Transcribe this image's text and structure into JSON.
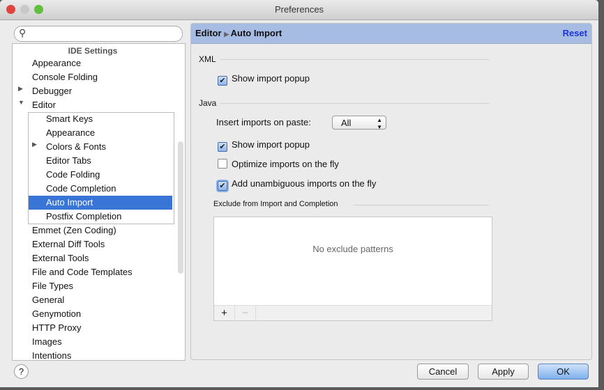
{
  "window": {
    "title": "Preferences"
  },
  "search": {
    "placeholder": ""
  },
  "tree": {
    "header": "IDE Settings",
    "items_top": [
      "Appearance",
      "Console Folding",
      "Debugger",
      "Editor"
    ],
    "editor_children": [
      "Smart Keys",
      "Appearance",
      "Colors & Fonts",
      "Editor Tabs",
      "Code Folding",
      "Code Completion",
      "Auto Import",
      "Postfix Completion"
    ],
    "items_bottom": [
      "Emmet (Zen Coding)",
      "External Diff Tools",
      "External Tools",
      "File and Code Templates",
      "File Types",
      "General",
      "Genymotion",
      "HTTP Proxy",
      "Images",
      "Intentions"
    ]
  },
  "header": {
    "breadcrumb_parent": "Editor",
    "breadcrumb_current": "Auto Import",
    "reset": "Reset"
  },
  "xml": {
    "title": "XML",
    "show_popup": "Show import popup",
    "show_popup_checked": true
  },
  "java": {
    "title": "Java",
    "insert_label": "Insert imports on paste:",
    "insert_value": "All",
    "show_popup": "Show import popup",
    "show_popup_checked": true,
    "optimize": "Optimize imports on the fly",
    "optimize_checked": false,
    "add_unambiguous": "Add unambiguous imports on the fly",
    "add_unambiguous_checked": true
  },
  "exclude": {
    "title": "Exclude from Import and Completion",
    "empty": "No exclude patterns",
    "add": "+",
    "remove": "−"
  },
  "buttons": {
    "help": "?",
    "cancel": "Cancel",
    "apply": "Apply",
    "ok": "OK"
  },
  "colors": {
    "header": "#a6bce3",
    "selection": "#3875d7",
    "reset": "#1a33dd"
  }
}
